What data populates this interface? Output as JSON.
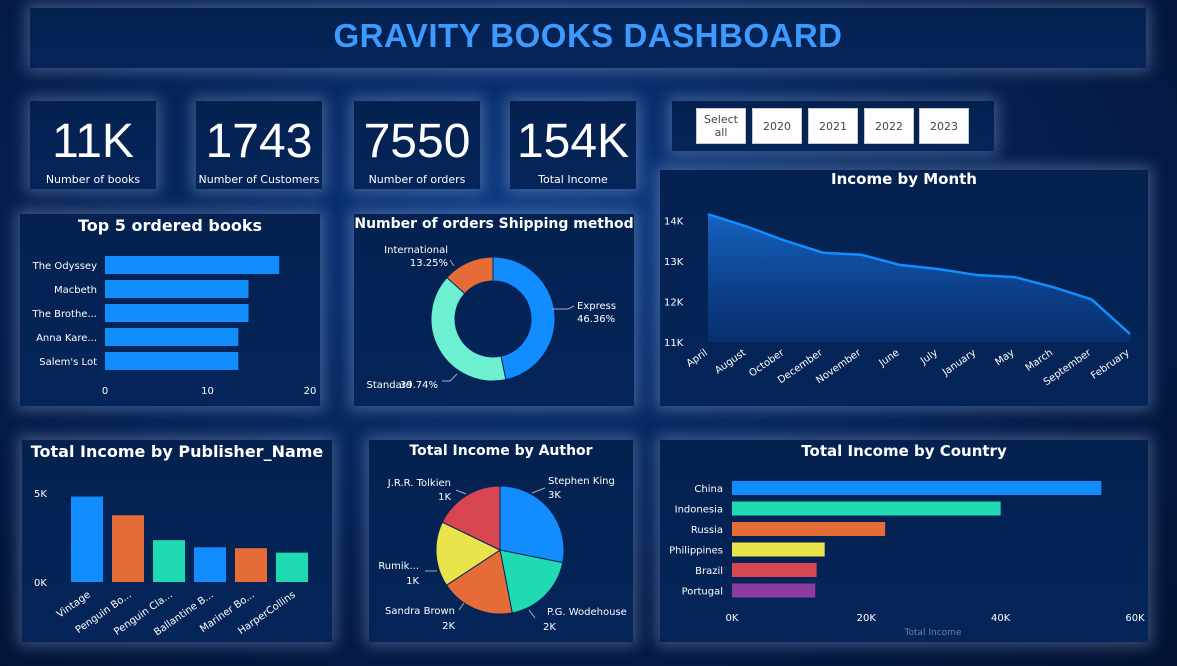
{
  "header": {
    "title": "GRAVITY BOOKS DASHBOARD"
  },
  "kpis": [
    {
      "value": "11K",
      "label": "Number of books"
    },
    {
      "value": "1743",
      "label": "Number of Customers"
    },
    {
      "value": "7550",
      "label": "Number of orders"
    },
    {
      "value": "154K",
      "label": "Total Income"
    }
  ],
  "slicer": {
    "options": [
      "Select all",
      "2020",
      "2021",
      "2022",
      "2023"
    ]
  },
  "chart_data": [
    {
      "id": "top_books",
      "type": "bar",
      "orientation": "horizontal",
      "title": "Top 5 ordered books",
      "categories": [
        "The Odyssey",
        "Macbeth",
        "The Brothe...",
        "Anna Kare...",
        "Salem's Lot"
      ],
      "values": [
        17,
        14,
        14,
        13,
        13
      ],
      "xlim": [
        0,
        20
      ],
      "xticks": [
        "0",
        "10",
        "20"
      ],
      "color": "#118dff"
    },
    {
      "id": "shipping",
      "type": "pie",
      "donut": true,
      "title": "Number of orders Shipping method",
      "slices": [
        {
          "name": "Express",
          "pct": "46.36%",
          "value": 46.36,
          "color": "#118dff"
        },
        {
          "name": "Standard",
          "pct": "39.74%",
          "value": 39.74,
          "color": "#6cf0d0"
        },
        {
          "name": "International",
          "pct": "13.25%",
          "value": 13.25,
          "color": "#e66c37"
        }
      ]
    },
    {
      "id": "income_month",
      "type": "area",
      "title": "Income by Month",
      "categories": [
        "April",
        "August",
        "October",
        "December",
        "November",
        "June",
        "July",
        "January",
        "May",
        "March",
        "September",
        "February"
      ],
      "values": [
        14150,
        13850,
        13500,
        13200,
        13150,
        12900,
        12800,
        12650,
        12600,
        12350,
        12050,
        11200
      ],
      "ylim": [
        11000,
        14500
      ],
      "yticks": [
        "11K",
        "12K",
        "13K",
        "14K"
      ],
      "color": "#118dff"
    },
    {
      "id": "publisher",
      "type": "bar",
      "title": "Total Income by Publisher_Name",
      "categories": [
        "Vintage",
        "Penguin Bo...",
        "Penguin Cla...",
        "Ballantine B...",
        "Mariner Bo...",
        "HarperCollins"
      ],
      "values": [
        4800,
        3750,
        2350,
        1950,
        1900,
        1650
      ],
      "colors": [
        "#118dff",
        "#e66c37",
        "#1fdbb2",
        "#118dff",
        "#e66c37",
        "#1fdbb2"
      ],
      "ylim": [
        0,
        5000
      ],
      "yticks": [
        "0K",
        "5K"
      ]
    },
    {
      "id": "author",
      "type": "pie",
      "title": "Total Income by Author",
      "slices": [
        {
          "name": "Stephen King",
          "label": "3K",
          "value": 3,
          "color": "#118dff"
        },
        {
          "name": "P.G. Wodehouse",
          "label": "2K",
          "value": 2,
          "color": "#1fdbb2"
        },
        {
          "name": "Sandra Brown",
          "label": "2K",
          "value": 2,
          "color": "#e66c37"
        },
        {
          "name": "Rumik...",
          "label": "1K",
          "value": 1.75,
          "color": "#e9e44c"
        },
        {
          "name": "J.R.R. Tolkien",
          "label": "1K",
          "value": 1.9,
          "color": "#d64550"
        }
      ]
    },
    {
      "id": "country",
      "type": "bar",
      "orientation": "horizontal",
      "title": "Total Income by Country",
      "categories": [
        "China",
        "Indonesia",
        "Russia",
        "Philippines",
        "Brazil",
        "Portugal"
      ],
      "values": [
        55000,
        40000,
        22800,
        13800,
        12600,
        12400
      ],
      "colors": [
        "#118dff",
        "#1fdbb2",
        "#e66c37",
        "#e9e44c",
        "#d64550",
        "#8e3b9e"
      ],
      "xlim": [
        0,
        60000
      ],
      "xticks": [
        "0K",
        "20K",
        "40K",
        "60K"
      ],
      "xlabel": "Total Income"
    }
  ]
}
